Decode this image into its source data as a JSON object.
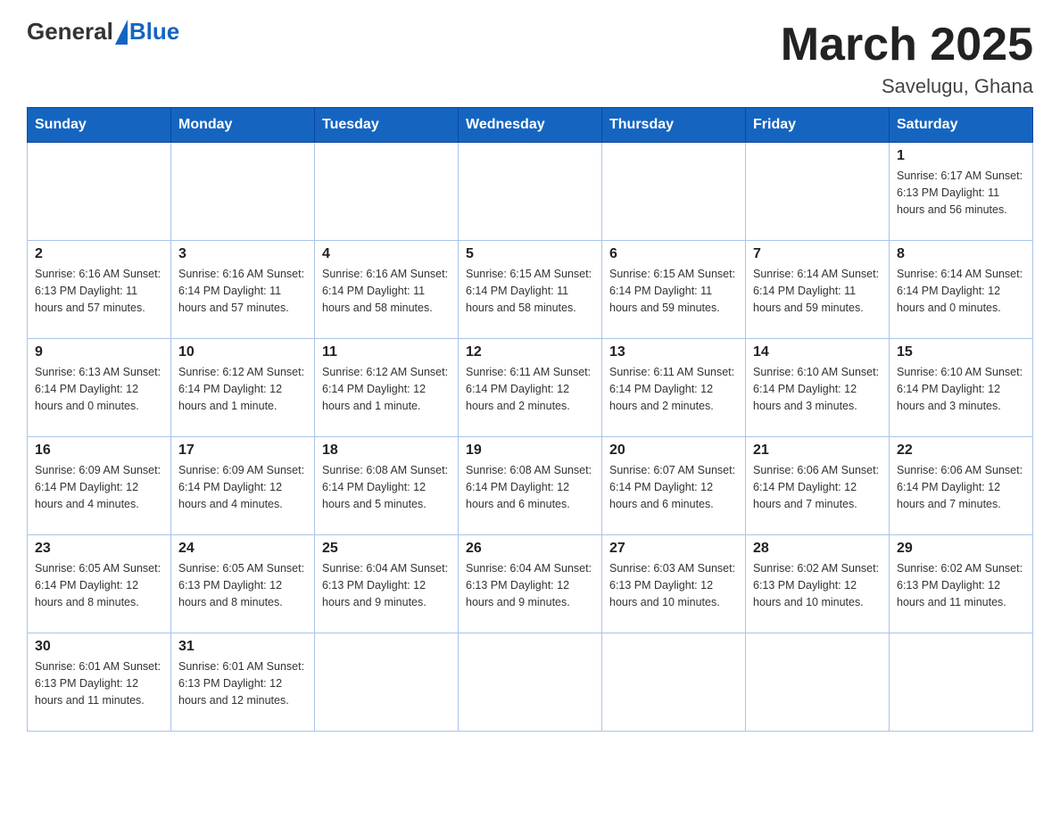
{
  "header": {
    "logo_general": "General",
    "logo_blue": "Blue",
    "title": "March 2025",
    "location": "Savelugu, Ghana"
  },
  "weekdays": [
    "Sunday",
    "Monday",
    "Tuesday",
    "Wednesday",
    "Thursday",
    "Friday",
    "Saturday"
  ],
  "weeks": [
    [
      {
        "day": "",
        "info": ""
      },
      {
        "day": "",
        "info": ""
      },
      {
        "day": "",
        "info": ""
      },
      {
        "day": "",
        "info": ""
      },
      {
        "day": "",
        "info": ""
      },
      {
        "day": "",
        "info": ""
      },
      {
        "day": "1",
        "info": "Sunrise: 6:17 AM\nSunset: 6:13 PM\nDaylight: 11 hours\nand 56 minutes."
      }
    ],
    [
      {
        "day": "2",
        "info": "Sunrise: 6:16 AM\nSunset: 6:13 PM\nDaylight: 11 hours\nand 57 minutes."
      },
      {
        "day": "3",
        "info": "Sunrise: 6:16 AM\nSunset: 6:14 PM\nDaylight: 11 hours\nand 57 minutes."
      },
      {
        "day": "4",
        "info": "Sunrise: 6:16 AM\nSunset: 6:14 PM\nDaylight: 11 hours\nand 58 minutes."
      },
      {
        "day": "5",
        "info": "Sunrise: 6:15 AM\nSunset: 6:14 PM\nDaylight: 11 hours\nand 58 minutes."
      },
      {
        "day": "6",
        "info": "Sunrise: 6:15 AM\nSunset: 6:14 PM\nDaylight: 11 hours\nand 59 minutes."
      },
      {
        "day": "7",
        "info": "Sunrise: 6:14 AM\nSunset: 6:14 PM\nDaylight: 11 hours\nand 59 minutes."
      },
      {
        "day": "8",
        "info": "Sunrise: 6:14 AM\nSunset: 6:14 PM\nDaylight: 12 hours\nand 0 minutes."
      }
    ],
    [
      {
        "day": "9",
        "info": "Sunrise: 6:13 AM\nSunset: 6:14 PM\nDaylight: 12 hours\nand 0 minutes."
      },
      {
        "day": "10",
        "info": "Sunrise: 6:12 AM\nSunset: 6:14 PM\nDaylight: 12 hours\nand 1 minute."
      },
      {
        "day": "11",
        "info": "Sunrise: 6:12 AM\nSunset: 6:14 PM\nDaylight: 12 hours\nand 1 minute."
      },
      {
        "day": "12",
        "info": "Sunrise: 6:11 AM\nSunset: 6:14 PM\nDaylight: 12 hours\nand 2 minutes."
      },
      {
        "day": "13",
        "info": "Sunrise: 6:11 AM\nSunset: 6:14 PM\nDaylight: 12 hours\nand 2 minutes."
      },
      {
        "day": "14",
        "info": "Sunrise: 6:10 AM\nSunset: 6:14 PM\nDaylight: 12 hours\nand 3 minutes."
      },
      {
        "day": "15",
        "info": "Sunrise: 6:10 AM\nSunset: 6:14 PM\nDaylight: 12 hours\nand 3 minutes."
      }
    ],
    [
      {
        "day": "16",
        "info": "Sunrise: 6:09 AM\nSunset: 6:14 PM\nDaylight: 12 hours\nand 4 minutes."
      },
      {
        "day": "17",
        "info": "Sunrise: 6:09 AM\nSunset: 6:14 PM\nDaylight: 12 hours\nand 4 minutes."
      },
      {
        "day": "18",
        "info": "Sunrise: 6:08 AM\nSunset: 6:14 PM\nDaylight: 12 hours\nand 5 minutes."
      },
      {
        "day": "19",
        "info": "Sunrise: 6:08 AM\nSunset: 6:14 PM\nDaylight: 12 hours\nand 6 minutes."
      },
      {
        "day": "20",
        "info": "Sunrise: 6:07 AM\nSunset: 6:14 PM\nDaylight: 12 hours\nand 6 minutes."
      },
      {
        "day": "21",
        "info": "Sunrise: 6:06 AM\nSunset: 6:14 PM\nDaylight: 12 hours\nand 7 minutes."
      },
      {
        "day": "22",
        "info": "Sunrise: 6:06 AM\nSunset: 6:14 PM\nDaylight: 12 hours\nand 7 minutes."
      }
    ],
    [
      {
        "day": "23",
        "info": "Sunrise: 6:05 AM\nSunset: 6:14 PM\nDaylight: 12 hours\nand 8 minutes."
      },
      {
        "day": "24",
        "info": "Sunrise: 6:05 AM\nSunset: 6:13 PM\nDaylight: 12 hours\nand 8 minutes."
      },
      {
        "day": "25",
        "info": "Sunrise: 6:04 AM\nSunset: 6:13 PM\nDaylight: 12 hours\nand 9 minutes."
      },
      {
        "day": "26",
        "info": "Sunrise: 6:04 AM\nSunset: 6:13 PM\nDaylight: 12 hours\nand 9 minutes."
      },
      {
        "day": "27",
        "info": "Sunrise: 6:03 AM\nSunset: 6:13 PM\nDaylight: 12 hours\nand 10 minutes."
      },
      {
        "day": "28",
        "info": "Sunrise: 6:02 AM\nSunset: 6:13 PM\nDaylight: 12 hours\nand 10 minutes."
      },
      {
        "day": "29",
        "info": "Sunrise: 6:02 AM\nSunset: 6:13 PM\nDaylight: 12 hours\nand 11 minutes."
      }
    ],
    [
      {
        "day": "30",
        "info": "Sunrise: 6:01 AM\nSunset: 6:13 PM\nDaylight: 12 hours\nand 11 minutes."
      },
      {
        "day": "31",
        "info": "Sunrise: 6:01 AM\nSunset: 6:13 PM\nDaylight: 12 hours\nand 12 minutes."
      },
      {
        "day": "",
        "info": ""
      },
      {
        "day": "",
        "info": ""
      },
      {
        "day": "",
        "info": ""
      },
      {
        "day": "",
        "info": ""
      },
      {
        "day": "",
        "info": ""
      }
    ]
  ]
}
